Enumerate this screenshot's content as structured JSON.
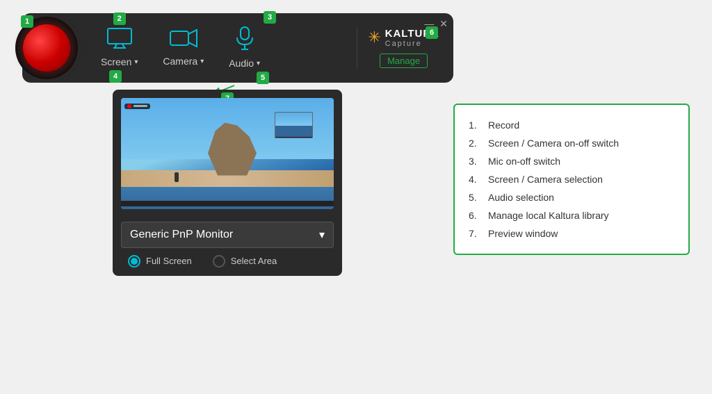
{
  "badges": {
    "b1": "1",
    "b2": "2",
    "b3": "3",
    "b4": "4",
    "b5": "5",
    "b6": "6",
    "b7": "7"
  },
  "toolbar": {
    "screen_label": "Screen",
    "camera_label": "Camera",
    "audio_label": "Audio"
  },
  "kaltura": {
    "brand": "KALTURA",
    "sub": "Capture",
    "manage": "Manage"
  },
  "window_controls": {
    "minimize": "—",
    "close": "✕"
  },
  "dropdown": {
    "monitor_label": "Generic PnP Monitor",
    "full_screen": "Full Screen",
    "select_area": "Select Area"
  },
  "info_items": [
    {
      "num": "1.",
      "text": "Record"
    },
    {
      "num": "2.",
      "text": "Screen / Camera on-off switch"
    },
    {
      "num": "3.",
      "text": "Mic on-off switch"
    },
    {
      "num": "4.",
      "text": "Screen / Camera selection"
    },
    {
      "num": "5.",
      "text": "Audio selection"
    },
    {
      "num": "6.",
      "text": "Manage local Kaltura library"
    },
    {
      "num": "7.",
      "text": "Preview window"
    }
  ]
}
